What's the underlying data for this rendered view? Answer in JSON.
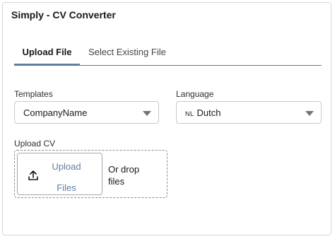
{
  "card": {
    "title": "Simply - CV Converter"
  },
  "tabs": [
    {
      "label": "Upload File",
      "active": true
    },
    {
      "label": "Select Existing File",
      "active": false
    }
  ],
  "templates": {
    "label": "Templates",
    "value": "CompanyName"
  },
  "language": {
    "label": "Language",
    "prefix": "NL",
    "value": "Dutch"
  },
  "upload": {
    "label": "Upload CV",
    "button_line1": "Upload",
    "button_line2": "Files",
    "drop_line1": "Or drop",
    "drop_line2": "files"
  },
  "colors": {
    "accent": "#5f7ea3",
    "border": "#c9c9c9",
    "text": "#181818"
  },
  "icons": {
    "upload": "upload-icon",
    "dropdown": "chevron-down-icon"
  }
}
